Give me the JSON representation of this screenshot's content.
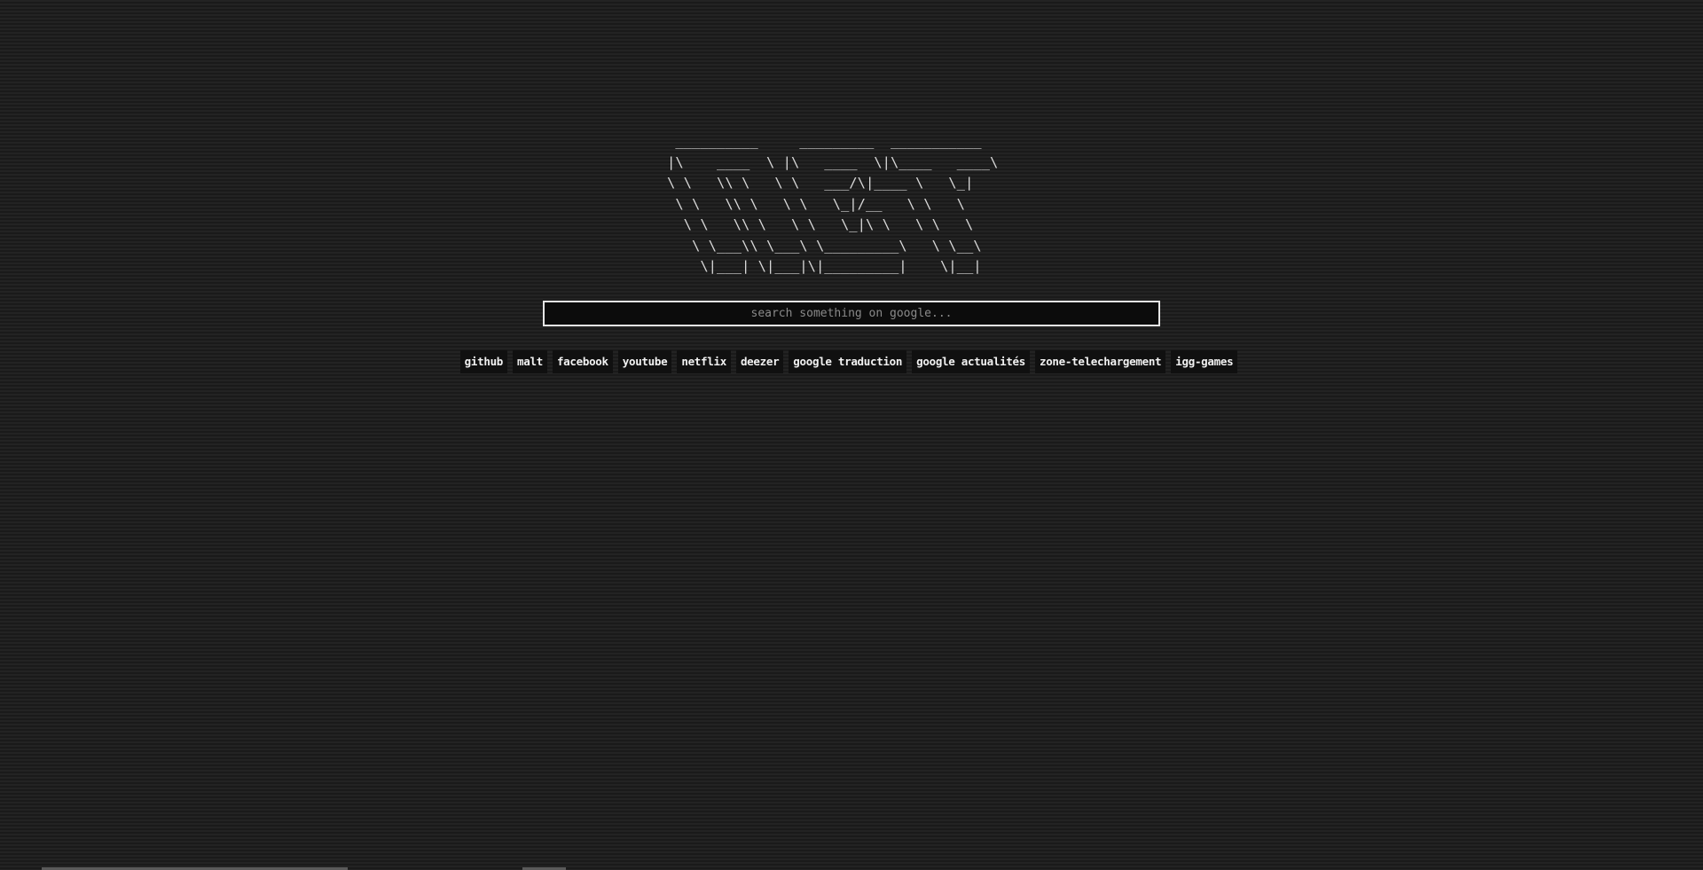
{
  "logo": {
    "ascii": " __________     _________  ___________\n|\\    ____  \\ |\\   ____  \\|\\____   ____\\\n\\ \\   \\\\ \\   \\ \\   ___/\\|____ \\   \\_|\n \\ \\   \\\\ \\   \\ \\   \\_|/__   \\ \\   \\\n  \\ \\   \\\\ \\   \\ \\   \\_|\\ \\   \\ \\   \\\n   \\ \\___\\\\ \\___\\ \\_________\\   \\ \\__\\\n    \\|___| \\|___|\\|_________|    \\|__|"
  },
  "search": {
    "placeholder": "search something on google...",
    "value": ""
  },
  "links": [
    {
      "label": "github"
    },
    {
      "label": "malt"
    },
    {
      "label": "facebook"
    },
    {
      "label": "youtube"
    },
    {
      "label": "netflix"
    },
    {
      "label": "deezer"
    },
    {
      "label": "google traduction"
    },
    {
      "label": "google actualités"
    },
    {
      "label": "zone-telechargement"
    },
    {
      "label": "igg-games"
    }
  ],
  "colors": {
    "background": "#1f1f1f",
    "text": "#f2f2f2",
    "link_background": "#101010",
    "search_border": "#e6e6e6"
  }
}
